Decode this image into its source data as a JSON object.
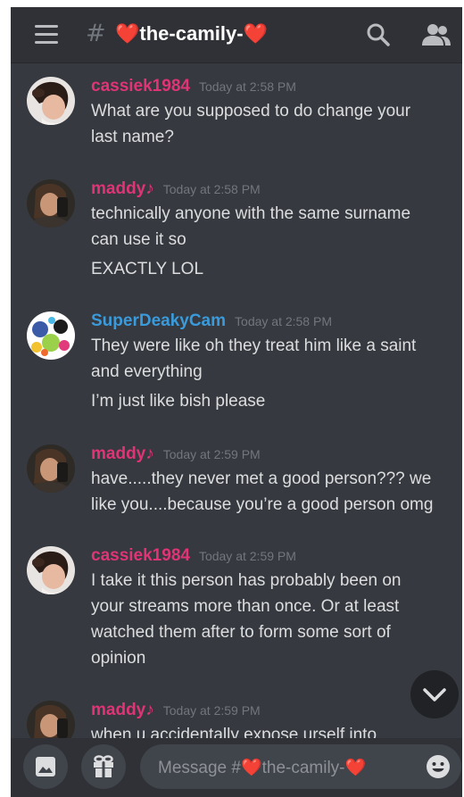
{
  "header": {
    "hash": "#",
    "channel": "❤️the-camily-❤️",
    "icons": [
      "hamburger-icon",
      "search-icon",
      "members-icon"
    ]
  },
  "messages": [
    {
      "user": "cassiek1984",
      "timestamp": "Today at 2:58 PM",
      "color": "#e03477",
      "lines": [
        "What are you supposed to do change your",
        "last name?"
      ]
    },
    {
      "user": "maddy♪",
      "timestamp": "Today at 2:58 PM",
      "color": "#e03477",
      "lines": [
        "technically anyone with the same surname",
        "can use it so",
        "EXACTLY LOL"
      ]
    },
    {
      "user": "SuperDeakyCam",
      "timestamp": "Today at 2:58 PM",
      "color": "#3a9bdc",
      "lines": [
        "They were like oh they treat him like a saint",
        "and everything",
        "I’m just like bish please"
      ]
    },
    {
      "user": "maddy♪",
      "timestamp": "Today at 2:59 PM",
      "color": "#e03477",
      "lines": [
        "have.....they never met a good person??? we",
        "like you....because you’re a good person omg"
      ]
    },
    {
      "user": "cassiek1984",
      "timestamp": "Today at 2:59 PM",
      "color": "#e03477",
      "lines": [
        "I take it this person has probably been on",
        "your streams more than once. Or at least",
        "watched them after to form some sort of",
        "opinion"
      ]
    },
    {
      "user": "maddy♪",
      "timestamp": "Today at 2:59 PM",
      "color": "#e03477",
      "lines": [
        "when u accidentally expose urself into"
      ]
    }
  ],
  "composer": {
    "placeholder": "Message #❤️the-camily-❤️",
    "icons": [
      "image-icon",
      "gift-icon",
      "emoji-icon"
    ]
  },
  "scroll_button": {
    "icon": "chevron-down-icon"
  }
}
